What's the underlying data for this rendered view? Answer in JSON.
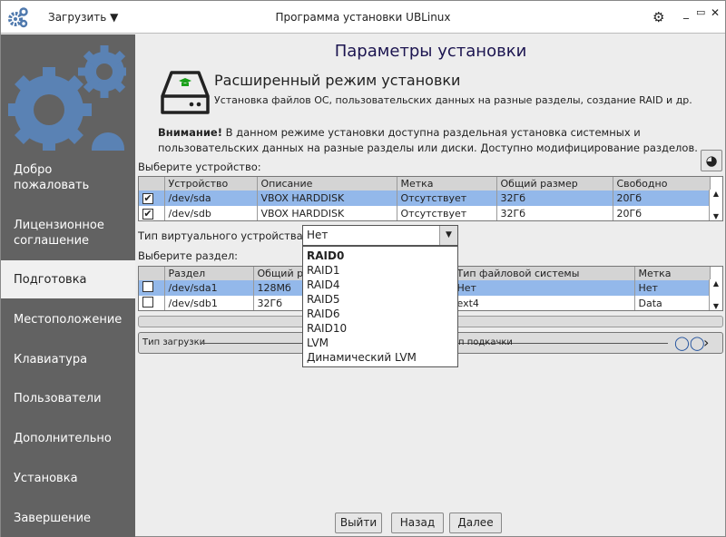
{
  "titlebar": {
    "menu": "Загрузить",
    "title": "Программа установки UBLinux"
  },
  "sidebar": {
    "items": [
      {
        "label": "Добро пожаловать"
      },
      {
        "label": "Лицензионное соглашение"
      },
      {
        "label": "Подготовка",
        "selected": true
      },
      {
        "label": "Местоположение"
      },
      {
        "label": "Клавиатура"
      },
      {
        "label": "Пользователи"
      },
      {
        "label": "Дополнительно"
      },
      {
        "label": "Установка"
      },
      {
        "label": "Завершение"
      }
    ]
  },
  "main": {
    "title": "Параметры установки",
    "mode_title": "Расширенный режим установки",
    "mode_desc": "Установка файлов ОС, пользовательских данных на разные разделы, создание RAID и др.",
    "warning_bold": "Внимание!",
    "warning_text": " В данном режиме установки доступна раздельная установка системных и пользовательских данных на разные разделы или диски. Доступно модифицирование разделов.",
    "device_label": "Выберите устройство:",
    "devices": {
      "headers": [
        "",
        "Устройство",
        "Описание",
        "Метка",
        "Общий размер",
        "Свободно"
      ],
      "rows": [
        {
          "checked": true,
          "device": "/dev/sda",
          "desc": "VBOX HARDDISK",
          "label": "Отсутствует",
          "size": "32Гб",
          "free": "20Гб"
        },
        {
          "checked": true,
          "device": "/dev/sdb",
          "desc": "VBOX HARDDISK",
          "label": "Отсутствует",
          "size": "32Гб",
          "free": "20Гб"
        }
      ]
    },
    "virtual_label": "Тип виртуального устройства:",
    "virtual_value": "Нет",
    "virtual_options": [
      "RAID0",
      "RAID1",
      "RAID4",
      "RAID5",
      "RAID6",
      "RAID10",
      "LVM",
      "Динамический LVM"
    ],
    "partition_label": "Выберите раздел:",
    "partitions": {
      "headers": [
        "",
        "Раздел",
        "Общий ра",
        "",
        "Тип файловой системы",
        "Метка"
      ],
      "rows": [
        {
          "checked": false,
          "part": "/dev/sda1",
          "size": "128Мб",
          "fs": "Нет",
          "label": "Нет"
        },
        {
          "checked": false,
          "part": "/dev/sdb1",
          "size": "32Гб",
          "fs": "ext4",
          "label": "Data"
        }
      ]
    },
    "boot_label": "Тип загрузки",
    "swap_label": "п подкачки"
  },
  "buttons": {
    "exit": "Выйти",
    "back": "Назад",
    "next": "Далее"
  },
  "colors": {
    "sidebar": "#626262",
    "selection": "#93b8ea",
    "gear": "#5a82b4",
    "title": "#1c1550"
  }
}
